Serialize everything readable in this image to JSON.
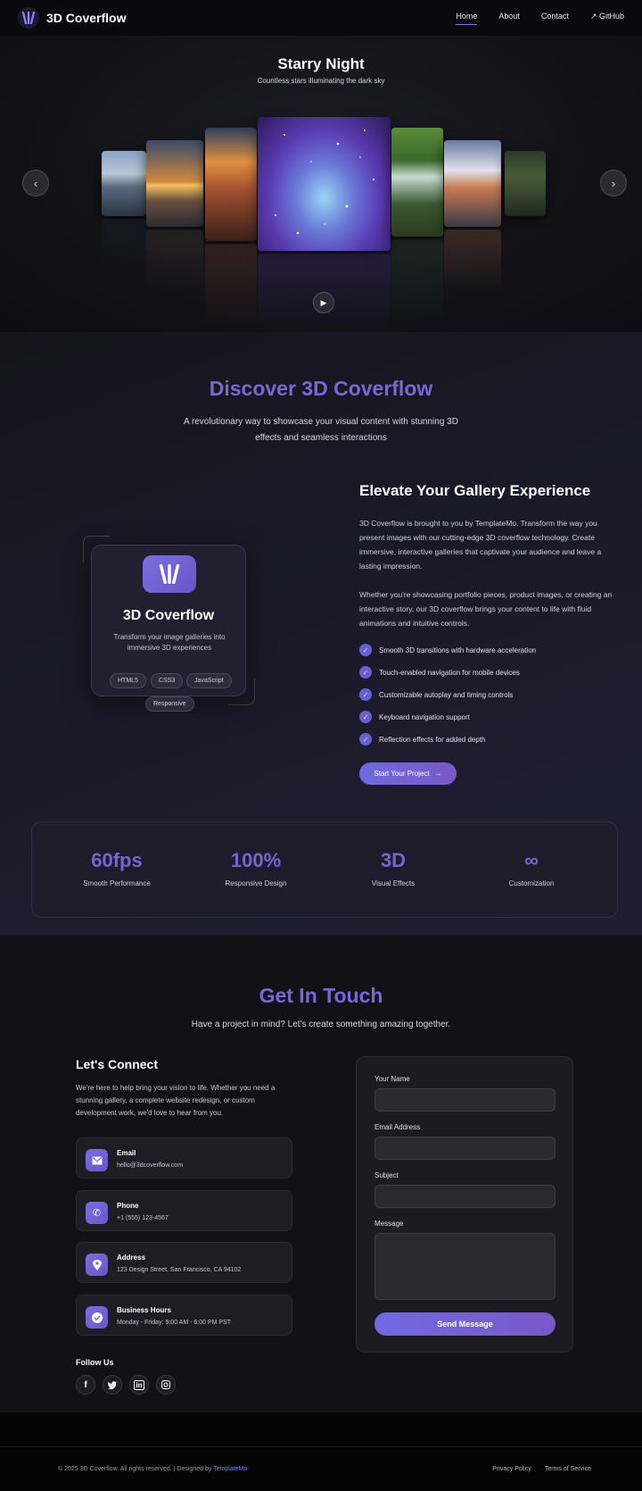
{
  "nav": {
    "brand": "3D Coverflow",
    "links": [
      {
        "label": "Home",
        "active": true
      },
      {
        "label": "About"
      },
      {
        "label": "Contact"
      },
      {
        "label": "↗ GitHub"
      }
    ]
  },
  "hero": {
    "title": "Starry Night",
    "subtitle": "Countless stars illuminating the dark sky",
    "prev_label": "‹",
    "next_label": "›",
    "play_label": "▶",
    "dots_total": 7,
    "dots_active_index": 5
  },
  "about": {
    "heading": "Discover 3D Coverflow",
    "lead": "A revolutionary way to showcase your visual content with stunning 3D effects and seamless interactions",
    "card": {
      "title": "3D Coverflow",
      "desc": "Transform your image galleries into immersive 3D experiences",
      "tags": [
        "HTML5",
        "CSS3",
        "JavaScript",
        "Responsive"
      ]
    },
    "elevate_title": "Elevate Your Gallery Experience",
    "para1": "3D Coverflow is brought to you by TemplateMo. Transform the way you present images with our cutting-edge 3D coverflow technology. Create immersive, interactive galleries that captivate your audience and leave a lasting impression.",
    "para2": "Whether you're showcasing portfolio pieces, product images, or creating an interactive story, our 3D coverflow brings your content to life with fluid animations and intuitive controls.",
    "features": [
      "Smooth 3D transitions with hardware acceleration",
      "Touch-enabled navigation for mobile devices",
      "Customizable autoplay and timing controls",
      "Keyboard navigation support",
      "Reflection effects for added depth"
    ],
    "cta": "Start Your Project",
    "stats": [
      {
        "value": "60fps",
        "label": "Smooth Performance"
      },
      {
        "value": "100%",
        "label": "Responsive Design"
      },
      {
        "value": "3D",
        "label": "Visual Effects"
      },
      {
        "value": "∞",
        "label": "Customization"
      }
    ]
  },
  "contact": {
    "heading": "Get In Touch",
    "sub": "Have a project in mind? Let's create something amazing together.",
    "connect_title": "Let's Connect",
    "connect_p": "We're here to help bring your vision to life. Whether you need a stunning gallery, a complete website redesign, or custom development work, we'd love to hear from you.",
    "info": [
      {
        "title": "Email",
        "value": "hello@3dcoverflow.com",
        "icon": "mail-icon"
      },
      {
        "title": "Phone",
        "value": "+1 (555) 123-4567",
        "icon": "phone-icon"
      },
      {
        "title": "Address",
        "value": "123 Design Street, San Francisco, CA 94102",
        "icon": "location-icon"
      },
      {
        "title": "Business Hours",
        "value": "Monday - Friday: 9:00 AM - 6:00 PM PST",
        "icon": "check-circle-icon"
      }
    ],
    "follow": "Follow Us",
    "form": {
      "name_label": "Your Name",
      "email_label": "Email Address",
      "subject_label": "Subject",
      "message_label": "Message",
      "send": "Send Message"
    }
  },
  "footer": {
    "copy": "© 2025 3D Coverflow. All rights reserved. | Designed by ",
    "designer": "TemplateMo",
    "links": [
      "Privacy Policy",
      "Terms of Service"
    ]
  }
}
